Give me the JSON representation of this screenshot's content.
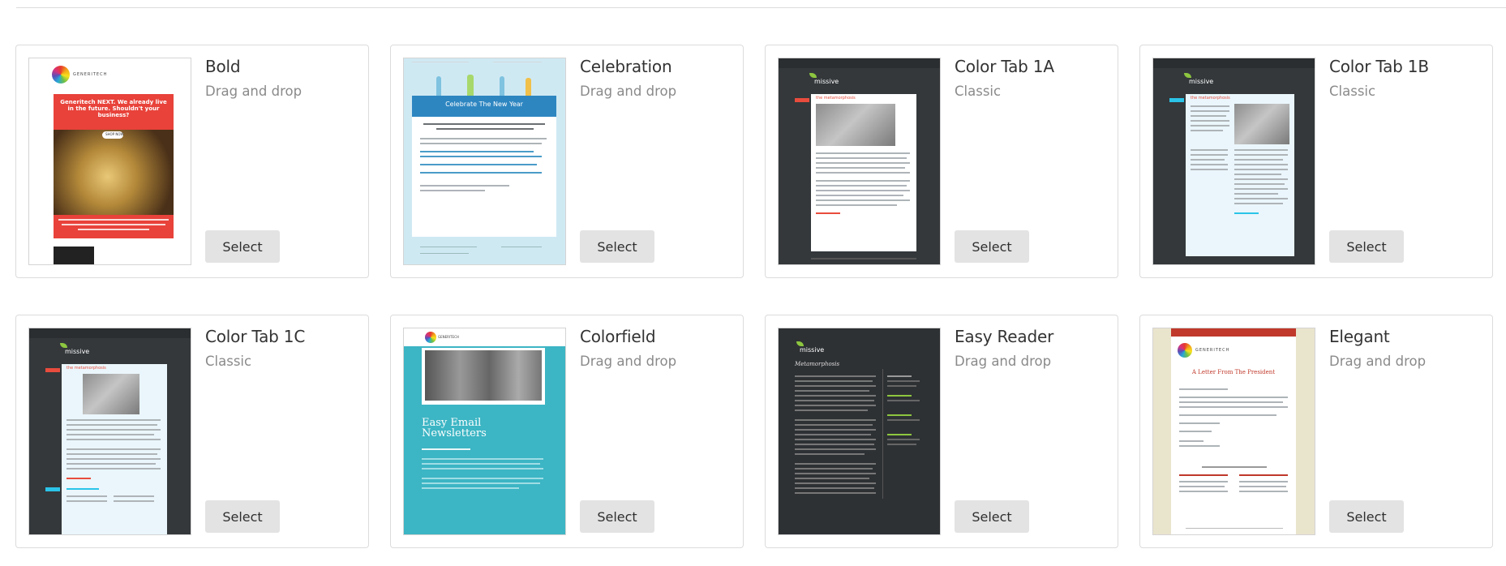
{
  "select_label": "Select",
  "templates": [
    {
      "id": "bold",
      "name": "Bold",
      "type": "Drag and drop"
    },
    {
      "id": "celebration",
      "name": "Celebration",
      "type": "Drag and drop"
    },
    {
      "id": "color-tab-1a",
      "name": "Color Tab 1A",
      "type": "Classic"
    },
    {
      "id": "color-tab-1b",
      "name": "Color Tab 1B",
      "type": "Classic"
    },
    {
      "id": "color-tab-1c",
      "name": "Color Tab 1C",
      "type": "Classic"
    },
    {
      "id": "colorfield",
      "name": "Colorfield",
      "type": "Drag and drop"
    },
    {
      "id": "easy-reader",
      "name": "Easy Reader",
      "type": "Drag and drop"
    },
    {
      "id": "elegant",
      "name": "Elegant",
      "type": "Drag and drop"
    }
  ],
  "thumbnails": {
    "bold": {
      "brand": "GENERITECH",
      "headline": "Generitech NEXT. We already live in the future. Shouldn't your business?",
      "button": "SHOP NOW"
    },
    "celebration": {
      "heading": "Celebrate The New Year"
    },
    "color_tab": {
      "brand": "missive",
      "heading": "the metamorphosis"
    },
    "colorfield": {
      "brand": "GENERITECH",
      "heading": "Easy Email Newsletters"
    },
    "easy_reader": {
      "brand": "missive",
      "heading": "Metamorphosis"
    },
    "elegant": {
      "brand": "GENERITECH",
      "heading": "A Letter From The President"
    }
  },
  "colors": {
    "accent_red": "#e8423a",
    "tab_red": "#e84c3d",
    "tab_cyan": "#2bc4e8",
    "colorfield_teal": "#3cb5c4",
    "button_bg": "#e3e3e3"
  }
}
